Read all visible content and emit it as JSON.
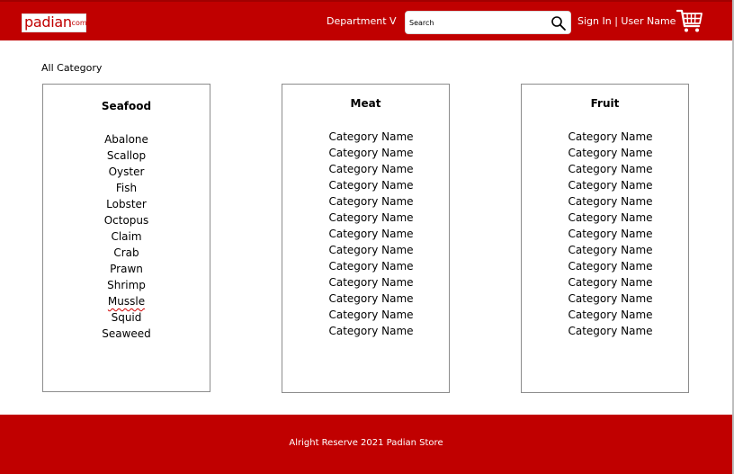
{
  "header": {
    "logo_text": "padian",
    "logo_suffix": ".com",
    "department_label": "Department V",
    "search": {
      "placeholder": "Search",
      "icon": "search-icon"
    },
    "signin_label": "Sign In | User Name",
    "cart_icon": "cart-icon",
    "colors": {
      "header_bg": "#c00000",
      "text": "#ffffff"
    }
  },
  "main": {
    "section_title": "All Category",
    "columns": [
      {
        "title": "Seafood",
        "items": [
          "Abalone",
          "Scallop",
          "Oyster",
          "Fish",
          "Lobster",
          "Octopus",
          "Claim",
          "Crab",
          "Prawn",
          "Shrimp",
          "Mussle",
          "Squid",
          "Seaweed"
        ]
      },
      {
        "title": "Meat",
        "items": [
          "Category Name",
          "Category Name",
          "Category Name",
          "Category Name",
          "Category Name",
          "Category Name",
          "Category Name",
          "Category Name",
          "Category Name",
          "Category Name",
          "Category Name",
          "Category Name",
          "Category Name"
        ]
      },
      {
        "title": "Fruit",
        "items": [
          "Category Name",
          "Category Name",
          "Category Name",
          "Category Name",
          "Category Name",
          "Category Name",
          "Category Name",
          "Category Name",
          "Category Name",
          "Category Name",
          "Category Name",
          "Category Name",
          "Category Name"
        ]
      }
    ]
  },
  "footer": {
    "text": "Alright Reserve 2021 Padian Store",
    "colors": {
      "footer_bg": "#c00000"
    }
  }
}
